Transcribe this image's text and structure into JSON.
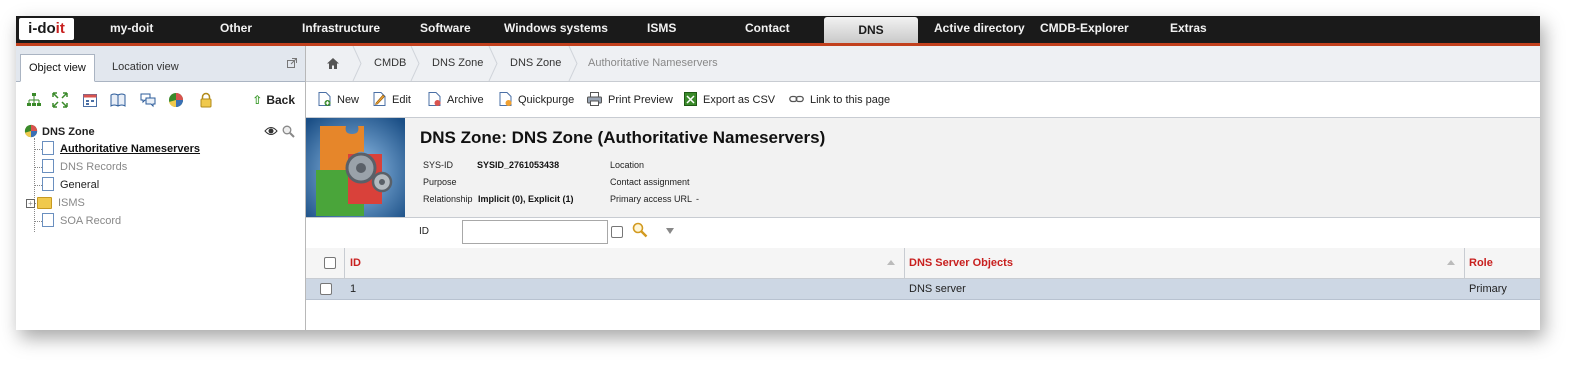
{
  "app": {
    "logo_text_main": "i-do",
    "logo_text_accent": "it"
  },
  "topnav": {
    "items": [
      {
        "label": "my-doit"
      },
      {
        "label": "Other"
      },
      {
        "label": "Infrastructure"
      },
      {
        "label": "Software"
      },
      {
        "label": "Windows systems"
      },
      {
        "label": "ISMS"
      },
      {
        "label": "Contact"
      },
      {
        "label": "DNS"
      },
      {
        "label": "Active directory"
      },
      {
        "label": "CMDB-Explorer"
      },
      {
        "label": "Extras"
      }
    ],
    "active": "DNS"
  },
  "leftpanel": {
    "tabs": [
      {
        "label": "Object view"
      },
      {
        "label": "Location view"
      }
    ],
    "back_label": "Back",
    "tree": {
      "root": "DNS Zone",
      "children": [
        {
          "label": "Authoritative Nameservers"
        },
        {
          "label": "DNS Records"
        },
        {
          "label": "General"
        },
        {
          "label": "ISMS"
        },
        {
          "label": "SOA Record"
        }
      ]
    }
  },
  "breadcrumb": [
    {
      "label": "CMDB"
    },
    {
      "label": "DNS Zone"
    },
    {
      "label": "DNS Zone"
    },
    {
      "label": "Authoritative Nameservers"
    }
  ],
  "toolbar": {
    "new": "New",
    "edit": "Edit",
    "archive": "Archive",
    "quickpurge": "Quickpurge",
    "print_preview": "Print Preview",
    "export_csv": "Export as CSV",
    "link_page": "Link to this page"
  },
  "header": {
    "title": "DNS Zone: DNS Zone (Authoritative Nameservers)",
    "sysid_label": "SYS-ID",
    "sysid_value": "SYSID_2761053438",
    "purpose_label": "Purpose",
    "relationship_label": "Relationship",
    "relationship_value": "Implicit (0), Explicit (1)",
    "location_label": "Location",
    "contact_label": "Contact assignment",
    "access_url_label": "Primary access URL",
    "access_url_value": "-"
  },
  "filter": {
    "label": "ID",
    "value": ""
  },
  "table": {
    "columns": [
      "ID",
      "DNS Server Objects",
      "Role"
    ],
    "rows": [
      [
        "1",
        "DNS server",
        "Primary"
      ]
    ]
  },
  "colors": {
    "accent_red": "#c8201f",
    "nav_bg": "#1a1a1a",
    "row_selected": "#cdd7e4"
  }
}
